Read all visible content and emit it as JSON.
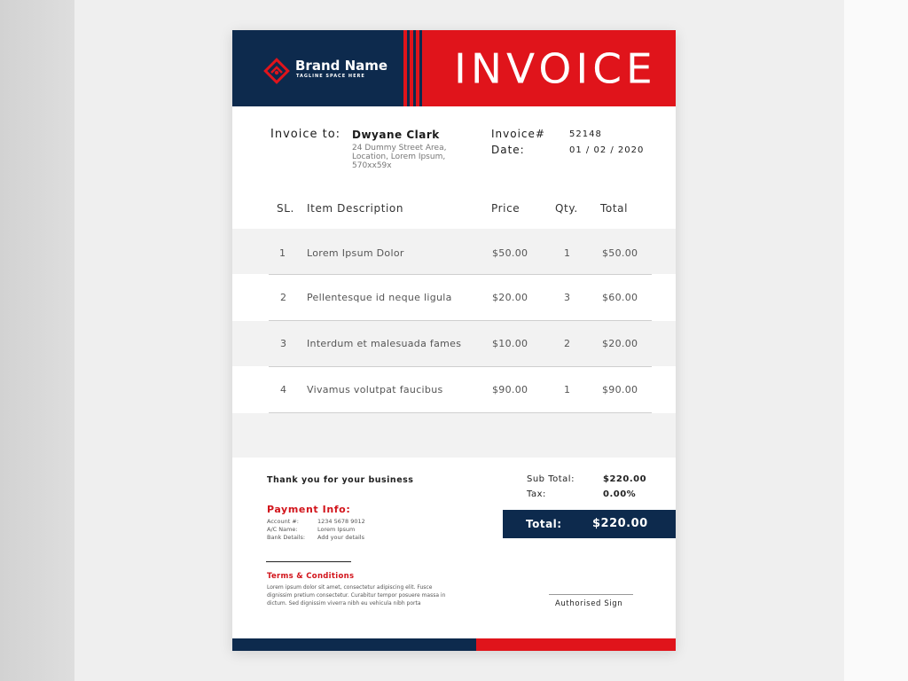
{
  "brand": {
    "name": "Brand Name",
    "tagline": "TAGLINE SPACE HERE",
    "logo_icon": "diamond-logo-icon"
  },
  "title": "INVOICE",
  "colors": {
    "navy": "#0d2a4d",
    "red": "#e0141b"
  },
  "bill_to": {
    "label": "Invoice to:",
    "name": "Dwyane Clark",
    "address_lines": [
      "24 Dummy Street Area,",
      "Location, Lorem Ipsum,",
      "570xx59x"
    ]
  },
  "meta": {
    "invoice_label": "Invoice#",
    "invoice_number": "52148",
    "date_label": "Date:",
    "date_value": "01 / 02 / 2020"
  },
  "table": {
    "headers": [
      "SL.",
      "Item Description",
      "Price",
      "Qty.",
      "Total"
    ],
    "rows": [
      [
        "1",
        "Lorem Ipsum Dolor",
        "$50.00",
        "1",
        "$50.00"
      ],
      [
        "2",
        "Pellentesque id neque ligula",
        "$20.00",
        "3",
        "$60.00"
      ],
      [
        "3",
        "Interdum et malesuada fames",
        "$10.00",
        "2",
        "$20.00"
      ],
      [
        "4",
        "Vivamus volutpat faucibus",
        "$90.00",
        "1",
        "$90.00"
      ]
    ]
  },
  "thank_you": "Thank you for your business",
  "summary": {
    "subtotal_label": "Sub Total:",
    "subtotal_value": "$220.00",
    "tax_label": "Tax:",
    "tax_value": "0.00%",
    "total_label": "Total:",
    "total_value": "$220.00"
  },
  "payment": {
    "heading": "Payment Info:",
    "rows": [
      {
        "label": "Account #:",
        "value": "1234 5678 9012"
      },
      {
        "label": "A/C Name:",
        "value": "Lorem Ipsum"
      },
      {
        "label": "Bank Details:",
        "value": "Add your details"
      }
    ]
  },
  "terms": {
    "heading": "Terms & Conditions",
    "lines": [
      "Lorem ipsum dolor sit amet, consectetur adipiscing elit. Fusce",
      "dignissim pretium consectetur. Curabitur tempor posuere massa in",
      "dictum. Sed dignissim viverra nibh eu vehicula nibh porta"
    ]
  },
  "signature_label": "Authorised Sign"
}
